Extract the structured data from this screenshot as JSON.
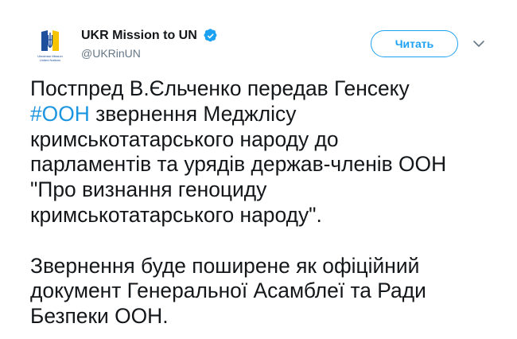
{
  "account": {
    "display_name": "UKR Mission to UN",
    "handle": "@UKRinUN",
    "avatar_caption_line1": "Ukrainian Mission",
    "avatar_caption_line2": "United Nations"
  },
  "actions": {
    "follow_label": "Читать"
  },
  "colors": {
    "accent": "#1da1f2",
    "hashtag": "#1b95e0",
    "text": "#14171a",
    "muted": "#657786",
    "flag_blue": "#1d4f9c",
    "flag_yellow": "#f6c400"
  },
  "icons": {
    "verified": "verified-badge-icon",
    "caret": "chevron-down-icon",
    "avatar": "ukraine-trident-logo"
  },
  "tweet": {
    "para1": {
      "line1": "Постпред В.Єльченко передав Генсеку",
      "hashtag": "#ООН",
      "line2_rest": " звернення Меджлісу",
      "line3": "кримськотатарського народу до",
      "line4": "парламентів та урядів держав-членів ООН",
      "line5": "\"Про визнання геноциду",
      "line6": "кримськотатарського народу\"."
    },
    "para2": {
      "line1": "Звернення буде поширене як офіційний",
      "line2": "документ Генеральної Асамблеї та Ради",
      "line3": "Безпеки ООН."
    }
  }
}
